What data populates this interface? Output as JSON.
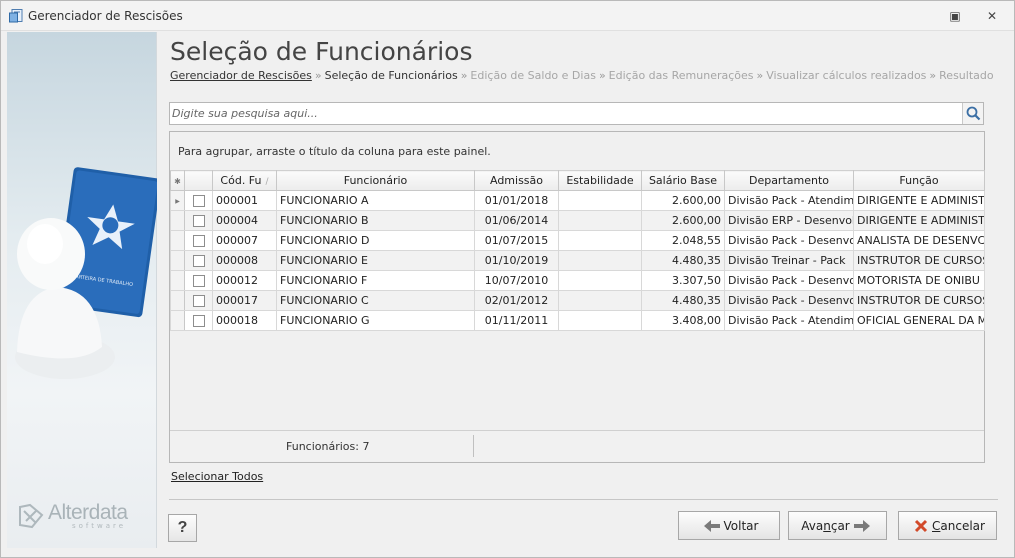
{
  "window": {
    "title": "Gerenciador de Rescisões",
    "restore_glyph": "▣",
    "close_glyph": "✕",
    "icon": "app-document-icon"
  },
  "sidebar": {
    "brand_name": "Alterdata",
    "brand_sub": "software",
    "card_text": "CARTEIRA DE TRABALHO"
  },
  "page": {
    "title": "Seleção de Funcionários",
    "breadcrumb": [
      {
        "label": "Gerenciador de Rescisões",
        "state": "link"
      },
      {
        "label": "Seleção de Funcionários",
        "state": "current"
      },
      {
        "label": "Edição de Saldo e Dias",
        "state": "disabled"
      },
      {
        "label": "Edição das Remunerações",
        "state": "disabled"
      },
      {
        "label": "Visualizar cálculos realizados",
        "state": "disabled"
      },
      {
        "label": "Resultado",
        "state": "disabled"
      }
    ],
    "breadcrumb_separator": "»"
  },
  "search": {
    "placeholder": "Digite sua pesquisa aqui...",
    "value": ""
  },
  "grid": {
    "group_panel_text": "Para agrupar, arraste o título da coluna para este painel.",
    "corner_glyph": "✱",
    "sort_glyph": "/",
    "current_row_glyph": "▶",
    "columns": [
      "Cód. Fu",
      "Funcionário",
      "Admissão",
      "Estabilidade",
      "Salário Base",
      "Departamento",
      "Função"
    ],
    "rows": [
      {
        "codigo": "000001",
        "funcionario": "FUNCIONARIO A",
        "admissao": "01/01/2018",
        "estabilidade": "",
        "salario": "2.600,00",
        "departamento": "Divisão Pack - Atendim",
        "funcao": "DIRIGENTE E ADMINIST",
        "current": true
      },
      {
        "codigo": "000004",
        "funcionario": "FUNCIONARIO B",
        "admissao": "01/06/2014",
        "estabilidade": "",
        "salario": "2.600,00",
        "departamento": "Divisão ERP - Desenvolv",
        "funcao": "DIRIGENTE E ADMINIST",
        "current": false
      },
      {
        "codigo": "000007",
        "funcionario": "FUNCIONARIO D",
        "admissao": "01/07/2015",
        "estabilidade": "",
        "salario": "2.048,55",
        "departamento": "Divisão Pack - Desenvol",
        "funcao": "ANALISTA DE DESENVC",
        "current": false
      },
      {
        "codigo": "000008",
        "funcionario": "FUNCIONARIO E",
        "admissao": "01/10/2019",
        "estabilidade": "",
        "salario": "4.480,35",
        "departamento": "Divisão Treinar - Pack",
        "funcao": "INSTRUTOR DE CURSOS",
        "current": false
      },
      {
        "codigo": "000012",
        "funcionario": "FUNCIONARIO F",
        "admissao": "10/07/2010",
        "estabilidade": "",
        "salario": "3.307,50",
        "departamento": "Divisão Pack - Desenvol",
        "funcao": "MOTORISTA DE ONIBU",
        "current": false
      },
      {
        "codigo": "000017",
        "funcionario": "FUNCIONARIO C",
        "admissao": "02/01/2012",
        "estabilidade": "",
        "salario": "4.480,35",
        "departamento": "Divisão Pack - Desenvol",
        "funcao": "INSTRUTOR DE CURSOS",
        "current": false
      },
      {
        "codigo": "000018",
        "funcionario": "FUNCIONARIO G",
        "admissao": "01/11/2011",
        "estabilidade": "",
        "salario": "3.408,00",
        "departamento": "Divisão Pack - Atendim",
        "funcao": "OFICIAL GENERAL DA M",
        "current": false
      }
    ],
    "footer_count": "Funcionários: 7"
  },
  "actions": {
    "select_all": "Selecionar Todos",
    "help": "?",
    "back": "Voltar",
    "next_prefix": "Ava",
    "next_accel": "n",
    "next_suffix": "çar",
    "cancel_accel": "C",
    "cancel_suffix": "ancelar"
  },
  "colors": {
    "window_bg": "#f0f0f0",
    "sidebar_top": "#c6d6df",
    "arrow_green": "#6a8f3d",
    "cancel_red": "#d24a2a",
    "card_blue": "#1f5fa8"
  }
}
